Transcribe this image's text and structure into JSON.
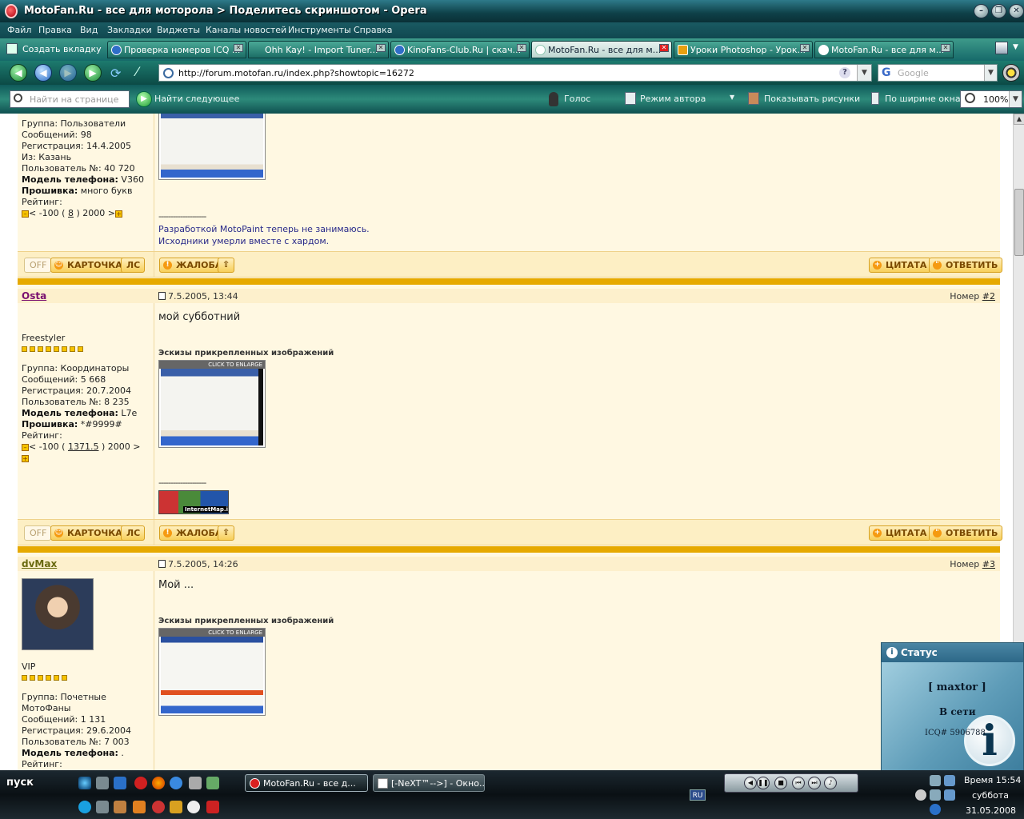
{
  "window": {
    "title": "MotoFan.Ru - все для моторола > Поделитесь скриншотом - Opera",
    "controls": {
      "minimize": "–",
      "restore": "❐",
      "close": "✕"
    }
  },
  "menu": [
    "Файл",
    "Правка",
    "Вид",
    "Закладки",
    "Виджеты",
    "Каналы новостей",
    "Инструменты",
    "Справка"
  ],
  "tabs": {
    "new_tab": "Создать вкладку",
    "items": [
      {
        "label": "Проверка номеров ICQ ..."
      },
      {
        "label": "Ohh Kay! - Import Tuner..."
      },
      {
        "label": "KinoFans-Club.Ru | скач..."
      },
      {
        "label": "MotoFan.Ru - все для м..."
      },
      {
        "label": "Уроки Photoshop - Урок..."
      },
      {
        "label": "MotoFan.Ru - все для м..."
      }
    ]
  },
  "address": {
    "url": "http://forum.motofan.ru/index.php?showtopic=16272",
    "search_placeholder": "Google"
  },
  "findbar": {
    "placeholder": "Найти на странице",
    "find_next": "Найти следующее",
    "voice": "Голос",
    "author_mode": "Режим автора",
    "show_images": "Показывать рисунки",
    "fit_width": "По ширине окна",
    "zoom": "100%"
  },
  "posts": [
    {
      "user_lines": {
        "group": "Группа: Пользователи",
        "messages": "Сообщений: 98",
        "registration": "Регистрация: 14.4.2005",
        "from": "Из: Казань",
        "user_no": "Пользователь №: 40 720",
        "phone_label": "Модель телефона:",
        "phone": " V360",
        "firmware_label": "Прошивка:",
        "firmware": " много букв",
        "rating_label": "Рейтинг:",
        "rating_pre": "< -100 ( ",
        "rating_value": "8",
        "rating_post": " ) 2000 >"
      },
      "signature_line": "--------------------",
      "signature": [
        "Разработкой MotoPaint теперь не занимаюсь.",
        "Исходники умерли вместе с хардом."
      ]
    },
    {
      "nick": "Osta",
      "date": "7.5.2005, 13:44",
      "number_label": "Номер ",
      "number": "#2",
      "title": "Freestyler",
      "stars": 8,
      "user_lines": {
        "group": "Группа: Координаторы",
        "messages": "Сообщений: 5 668",
        "registration": "Регистрация: 20.7.2004",
        "user_no": "Пользователь №: 8 235",
        "phone_label": "Модель телефона:",
        "phone": " L7e",
        "firmware_label": "Прошивка:",
        "firmware": " *#9999#",
        "rating_label": "Рейтинг:",
        "rating_pre": "< -100 ( ",
        "rating_value": "1371.5",
        "rating_post": " ) 2000 >"
      },
      "text": "мой субботний",
      "attach_label": "Эскизы прикрепленных изображений",
      "enlarge": "CLICK TO ENLARGE",
      "signature_line": "--------------------",
      "sig_logo": "InternetMap.info"
    },
    {
      "nick": "dvMax",
      "date": "7.5.2005, 14:26",
      "number_label": "Номер ",
      "number": "#3",
      "title": "VIP",
      "stars": 6,
      "user_lines": {
        "group": "Группа: Почетные",
        "group2": "МотоФаны",
        "messages": "Сообщений: 1 131",
        "registration": "Регистрация: 29.6.2004",
        "user_no": "Пользователь №: 7 003",
        "phone_label": "Модель телефона:",
        "phone": " .",
        "rating_label": "Рейтинг:"
      },
      "text": "Мой ...",
      "attach_label": "Эскизы прикрепленных изображений",
      "enlarge": "CLICK TO ENLARGE"
    }
  ],
  "buttons": {
    "off": "OFF",
    "card": "КАРТОЧКА",
    "pm": "ЛС",
    "report": "ЖАЛОБА",
    "up": "⇧",
    "quote": "ЦИТАТА",
    "reply": "ОТВЕТИТЬ"
  },
  "status_popup": {
    "header": "Статус",
    "name": "[ maxtor ]",
    "state": "В сети",
    "icq": "ICQ# 5906788"
  },
  "taskbar": {
    "start": "пуск",
    "tasks": [
      "MotoFan.Ru - все д...",
      "[-NeXT™-->] - Окно..."
    ],
    "lang": "RU",
    "time": "Время 15:54",
    "day": "суббота",
    "date": "31.05.2008"
  }
}
